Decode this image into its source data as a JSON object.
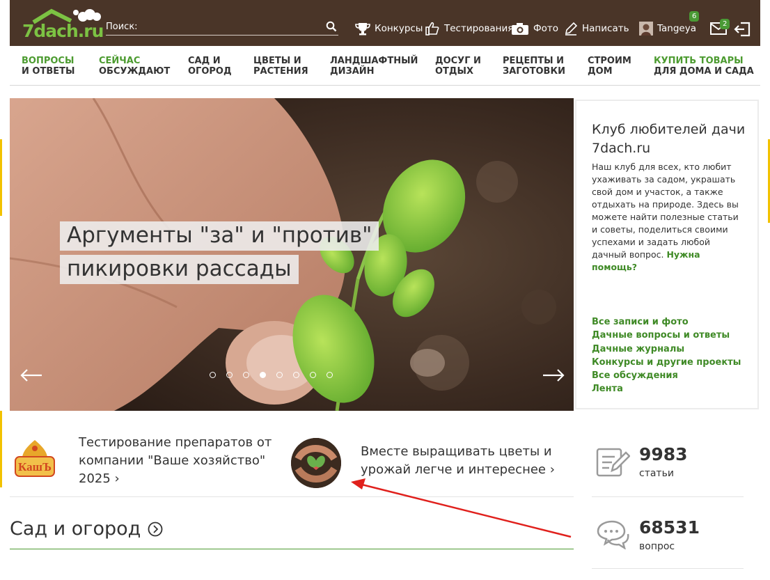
{
  "header": {
    "logo_text": "7dach.ru",
    "search_label": "Поиск:",
    "links": [
      {
        "label": "Конкурсы",
        "icon": "trophy-icon"
      },
      {
        "label": "Тестирования",
        "icon": "thumbs-up-icon"
      },
      {
        "label": "Фото",
        "icon": "camera-icon"
      },
      {
        "label": "Написать",
        "icon": "pencil-icon"
      }
    ],
    "user": {
      "name": "Tangeya",
      "badge": "6"
    },
    "messages_badge": "2"
  },
  "mainnav": [
    {
      "line1": "Вопросы",
      "line2": "и ответы",
      "line1_green": true,
      "line2_green": false
    },
    {
      "line1": "Сейчас",
      "line2": "обсуждают",
      "line1_green": true,
      "line2_green": false
    },
    {
      "line1": "Сад и",
      "line2": "огород"
    },
    {
      "line1": "Цветы и",
      "line2": "растения"
    },
    {
      "line1": "Ландшафтный",
      "line2": "дизайн"
    },
    {
      "line1": "Досуг и",
      "line2": "отдых"
    },
    {
      "line1": "Рецепты и",
      "line2": "заготовки"
    },
    {
      "line1": "Строим",
      "line2": "дом"
    },
    {
      "line1": "Купить товары",
      "line2": "для дома и сада",
      "line1_green": true
    }
  ],
  "hero": {
    "title_line1": "Аргументы \"за\" и \"против\"",
    "title_line2": "пикировки рассады",
    "slides_count": 8,
    "active_slide": 4
  },
  "club": {
    "title": "Клуб любителей дачи 7dach.ru",
    "text": "Наш клуб для всех, кто любит ухаживать за садом, украшать свой дом и участок, а также отдыхать на природе. Здесь вы можете найти полезные статьи и советы, поделиться своими успехами и задать любой дачный вопрос.",
    "help_link": "Нужна помощь?",
    "links": [
      "Все записи и фото",
      "Дачные вопросы и ответы",
      "Дачные журналы",
      "Конкурсы и другие проекты",
      "Все обсуждения",
      "Лента"
    ]
  },
  "promos": [
    {
      "text": "Тестирование препаратов от компании \"Ваше хозяйство\" 2025"
    },
    {
      "text": "Вместе выращивать цветы и урожай легче и интереснее"
    }
  ],
  "promo_logo_text": "КашЪ",
  "section": {
    "title": "Сад и огород"
  },
  "stats": [
    {
      "value": "9983",
      "label": "статьи",
      "icon": "edit-note-icon"
    },
    {
      "value": "68531",
      "label": "вопрос",
      "icon": "chat-bubbles-icon"
    }
  ],
  "colors": {
    "header_bg": "#4a3528",
    "brand_green": "#4c9b30",
    "logo_green": "#7cc243",
    "annotation_red": "#e0201c"
  }
}
